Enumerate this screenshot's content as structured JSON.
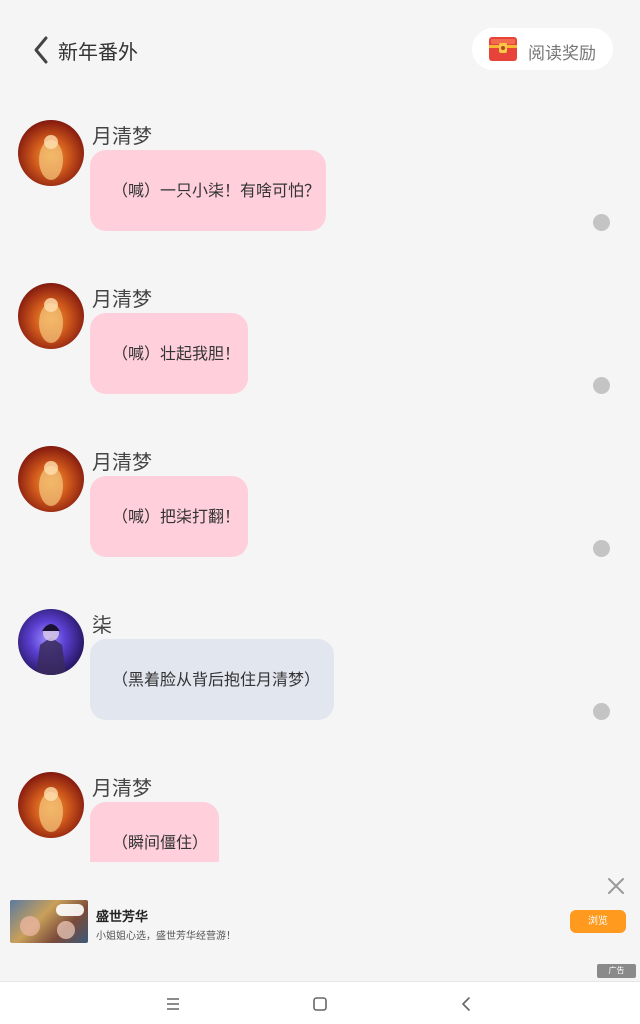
{
  "header": {
    "title": "新年番外",
    "reward_label": "阅读奖励"
  },
  "messages": [
    {
      "name": "月清梦",
      "text": "（喊）一只小柒！有啥可怕？",
      "style": "pink"
    },
    {
      "name": "月清梦",
      "text": "（喊）壮起我胆！",
      "style": "pink"
    },
    {
      "name": "月清梦",
      "text": "（喊）把柒打翻！",
      "style": "pink"
    },
    {
      "name": "柒",
      "text": "（黑着脸从背后抱住月清梦）",
      "style": "blue"
    },
    {
      "name": "月清梦",
      "text": "（瞬间僵住）",
      "style": "pink"
    }
  ],
  "ad": {
    "title": "盛世芳华",
    "description": "小姐姐心选，盛世芳华经营游！",
    "cta": "浏览",
    "badge": "广告"
  },
  "colors": {
    "background": "#f5f5f5",
    "bubble_pink": "#ffd0db",
    "bubble_blue": "#e1e6ef",
    "cta": "#ff9a1f"
  },
  "icons": [
    "back-arrow-icon",
    "treasure-chest-icon",
    "close-icon",
    "menu-icon",
    "home-icon",
    "back-icon"
  ]
}
